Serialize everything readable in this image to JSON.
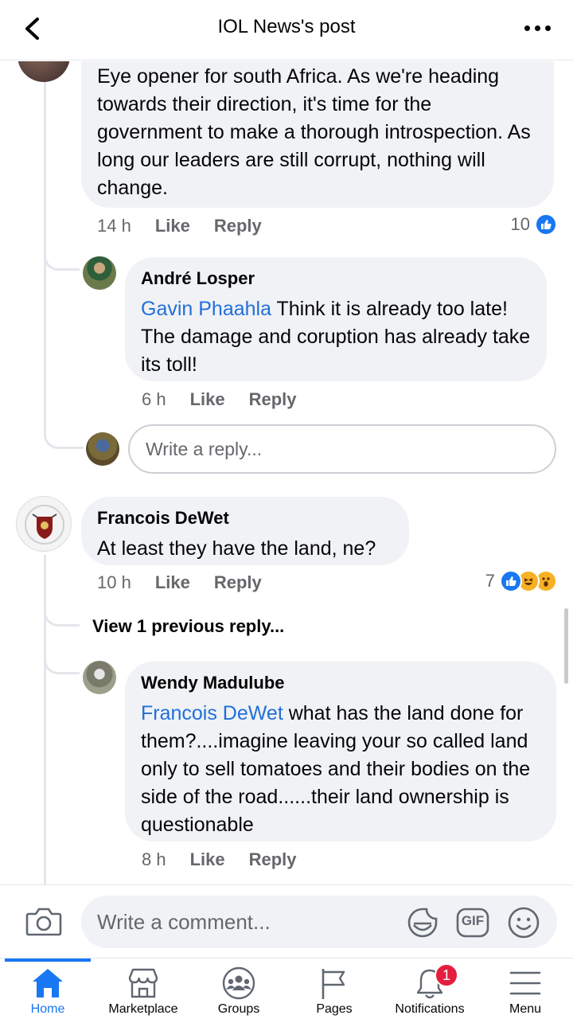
{
  "header": {
    "title": "IOL News's post"
  },
  "comments": [
    {
      "text": "Eye opener for south Africa. As we're heading towards their direction, it's time for the government to make a thorough introspection. As long our leaders are still corrupt, nothing will change.",
      "time": "14 h",
      "like": "Like",
      "reply": "Reply",
      "reaction_count": "10",
      "replies": [
        {
          "author": "André Losper",
          "mention": "Gavin Phaahla",
          "text": " Think it is already too late! The damage and coruption has already take its toll!",
          "time": "6 h",
          "like": "Like",
          "reply": "Reply"
        }
      ],
      "reply_placeholder": "Write a reply..."
    },
    {
      "author": "Francois DeWet",
      "text": "At least they have the land, ne?",
      "time": "10 h",
      "like": "Like",
      "reply": "Reply",
      "reaction_count": "7",
      "view_previous": "View 1 previous reply...",
      "replies": [
        {
          "author": "Wendy Madulube",
          "mention": "Francois DeWet",
          "text": " what has the land done for them?....imagine leaving your so called land only to sell tomatoes and their bodies on the side of the road......their land ownership is questionable",
          "time": "8 h",
          "like": "Like",
          "reply": "Reply"
        }
      ]
    }
  ],
  "composer": {
    "placeholder": "Write a comment...",
    "gif_label": "GIF"
  },
  "nav": [
    {
      "label": "Home",
      "icon": "home-icon"
    },
    {
      "label": "Marketplace",
      "icon": "marketplace-icon"
    },
    {
      "label": "Groups",
      "icon": "groups-icon"
    },
    {
      "label": "Pages",
      "icon": "pages-icon"
    },
    {
      "label": "Notifications",
      "icon": "notifications-icon",
      "badge": "1"
    },
    {
      "label": "Menu",
      "icon": "menu-icon"
    }
  ],
  "colors": {
    "accent": "#1877f2",
    "mention": "#216fdb",
    "bubble": "#f0f2f5",
    "badge": "#e41e3f"
  }
}
